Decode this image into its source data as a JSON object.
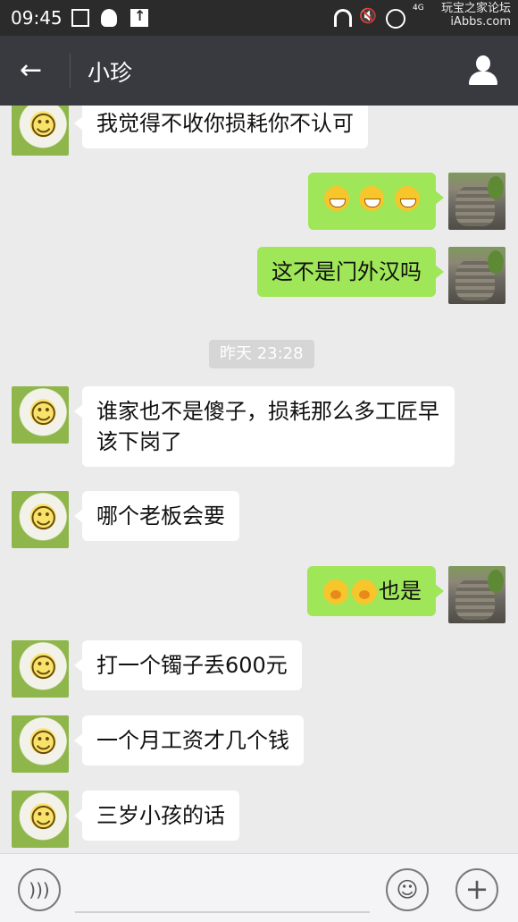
{
  "status_bar": {
    "time": "09:45",
    "network": "4G",
    "watermark_line1": "玩宝之家论坛",
    "watermark_line2": "iAbbs.com"
  },
  "header": {
    "back_icon": "arrow-left-icon",
    "title": "小珍",
    "profile_icon": "user-icon"
  },
  "messages": [
    {
      "side": "in",
      "text": "我觉得不收你损耗你不认可"
    },
    {
      "side": "out",
      "emoji": [
        "grin",
        "grin",
        "grin"
      ]
    },
    {
      "side": "out",
      "text": "这不是门外汉吗"
    },
    {
      "timestamp": "昨天 23:28"
    },
    {
      "side": "in",
      "text": "谁家也不是傻子，损耗那么多工匠早该下岗了"
    },
    {
      "side": "in",
      "text": "哪个老板会要"
    },
    {
      "side": "out",
      "emoji": [
        "cover",
        "cover"
      ],
      "text": "也是"
    },
    {
      "side": "in",
      "text": "打一个镯子丢600元"
    },
    {
      "side": "in",
      "text": "一个月工资才几个钱"
    },
    {
      "side": "in",
      "text": "三岁小孩的话"
    }
  ],
  "input_bar": {
    "voice_icon": "voice-icon",
    "emoji_icon": "smiley-icon",
    "plus_icon": "plus-icon"
  },
  "colors": {
    "titlebar": "#393a3f",
    "background": "#ebebeb",
    "outgoing_bubble": "#9fe658",
    "incoming_bubble": "#ffffff"
  }
}
